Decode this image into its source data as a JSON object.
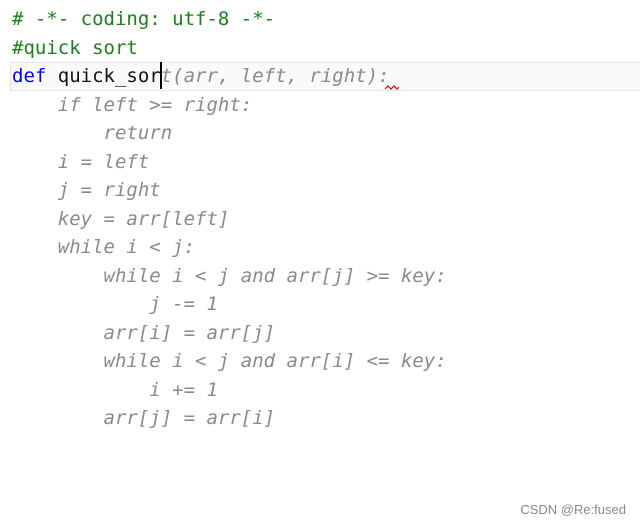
{
  "editor": {
    "lines": [
      {
        "segments": [
          {
            "t": "# -*- coding: utf-8 -*-",
            "k": "comment"
          }
        ]
      },
      {
        "segments": [
          {
            "t": "#quick sort",
            "k": "comment"
          }
        ]
      },
      {
        "segments": [
          {
            "t": "def",
            "k": "kw"
          },
          {
            "t": " quick_sor",
            "k": "name"
          },
          {
            "t": "t(arr, left, right):",
            "k": "ghost"
          }
        ]
      },
      {
        "segments": [
          {
            "t": "    if left >= right:",
            "k": "ghost"
          }
        ]
      },
      {
        "segments": [
          {
            "t": "        return",
            "k": "ghost"
          }
        ]
      },
      {
        "segments": [
          {
            "t": "    i = left",
            "k": "ghost"
          }
        ]
      },
      {
        "segments": [
          {
            "t": "    j = right",
            "k": "ghost"
          }
        ]
      },
      {
        "segments": [
          {
            "t": "    key = arr[left]",
            "k": "ghost"
          }
        ]
      },
      {
        "segments": [
          {
            "t": "    while i < j:",
            "k": "ghost"
          }
        ]
      },
      {
        "segments": [
          {
            "t": "        while i < j and arr[j] >= key:",
            "k": "ghost"
          }
        ]
      },
      {
        "segments": [
          {
            "t": "            j -= 1",
            "k": "ghost"
          }
        ]
      },
      {
        "segments": [
          {
            "t": "        arr[i] = arr[j]",
            "k": "ghost"
          }
        ]
      },
      {
        "segments": [
          {
            "t": "        while i < j and arr[i] <= key:",
            "k": "ghost"
          }
        ]
      },
      {
        "segments": [
          {
            "t": "            i += 1",
            "k": "ghost"
          }
        ]
      },
      {
        "segments": [
          {
            "t": "        arr[j] = arr[i]",
            "k": "ghost"
          }
        ]
      }
    ]
  },
  "watermark": "CSDN @Re:fused",
  "colors": {
    "comment": "#1a7f1a",
    "keyword": "#0000ff",
    "ghost": "#8a8a8a",
    "squiggle": "#e00000"
  }
}
